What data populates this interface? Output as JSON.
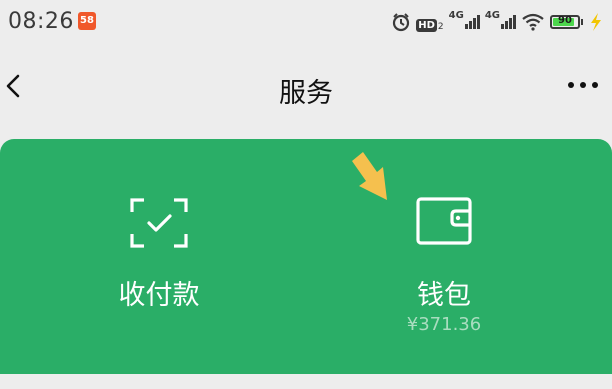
{
  "status_bar": {
    "time": "08:26",
    "app_badge": "58",
    "hd_label": "HD",
    "hd_sub": "2",
    "network_1": "4G",
    "network_2": "4G",
    "battery_level": "90",
    "battery_fraction": 0.9,
    "accent_color": "#4cd64c"
  },
  "nav": {
    "title": "服务"
  },
  "card": {
    "background_color": "#2aae67",
    "items": [
      {
        "label": "收付款",
        "icon": "scan-pay-icon"
      },
      {
        "label": "钱包",
        "icon": "wallet-icon",
        "amount": "¥371.36"
      }
    ]
  },
  "annotation": {
    "arrow_color": "#f5c04e",
    "icon": "arrow-down-left-icon"
  }
}
